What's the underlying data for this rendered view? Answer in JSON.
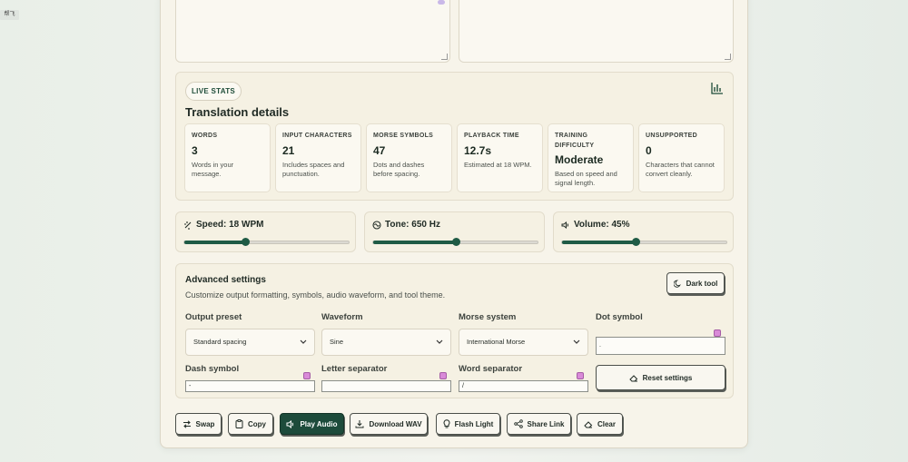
{
  "corner_tag": "帮飞",
  "stats_card": {
    "badge": "LIVE STATS",
    "title": "Translation details",
    "stats": [
      {
        "label": "WORDS",
        "value": "3",
        "desc": "Words in your message."
      },
      {
        "label": "INPUT CHARACTERS",
        "value": "21",
        "desc": "Includes spaces and punctuation."
      },
      {
        "label": "MORSE SYMBOLS",
        "value": "47",
        "desc": "Dots and dashes before spacing."
      },
      {
        "label": "PLAYBACK TIME",
        "value": "12.7s",
        "desc": "Estimated at 18 WPM."
      },
      {
        "label": "TRAINING DIFFICULTY",
        "value": "Moderate",
        "desc": "Based on speed and signal length."
      },
      {
        "label": "UNSUPPORTED",
        "value": "0",
        "desc": "Characters that cannot convert cleanly."
      }
    ]
  },
  "sliders": [
    {
      "label": "Speed: 18 WPM",
      "icon": "gauge-icon",
      "percent": 37
    },
    {
      "label": "Tone: 650 Hz",
      "icon": "tone-icon",
      "percent": 50
    },
    {
      "label": "Volume: 45%",
      "icon": "volume-icon",
      "percent": 45
    }
  ],
  "advanced": {
    "title": "Advanced settings",
    "subtitle": "Customize output formatting, symbols, audio waveform, and tool theme.",
    "dark_tool_label": "Dark tool",
    "output_preset": {
      "label": "Output preset",
      "value": "Standard spacing"
    },
    "waveform": {
      "label": "Waveform",
      "value": "Sine"
    },
    "morse_system": {
      "label": "Morse system",
      "value": "International Morse"
    },
    "dot_symbol": {
      "label": "Dot symbol",
      "value": "."
    },
    "dash_symbol": {
      "label": "Dash symbol",
      "value": "-"
    },
    "letter_separator": {
      "label": "Letter separator",
      "value": ""
    },
    "word_separator": {
      "label": "Word separator",
      "value": "/"
    },
    "reset_label": "Reset settings"
  },
  "actions": [
    {
      "label": "Swap",
      "name": "swap-button",
      "icon": "swap-icon"
    },
    {
      "label": "Copy",
      "name": "copy-button",
      "icon": "clipboard-icon"
    },
    {
      "label": "Play Audio",
      "name": "play-audio-button",
      "icon": "speaker-icon"
    },
    {
      "label": "Download WAV",
      "name": "download-wav-button",
      "icon": "download-icon"
    },
    {
      "label": "Flash Light",
      "name": "flash-light-button",
      "icon": "bulb-icon"
    },
    {
      "label": "Share Link",
      "name": "share-link-button",
      "icon": "share-icon"
    },
    {
      "label": "Clear",
      "name": "clear-button",
      "icon": "eraser-icon"
    }
  ],
  "colors": {
    "accent": "#1d4b3b",
    "panel": "#f7f4ea",
    "badge": "#d98ad8"
  }
}
